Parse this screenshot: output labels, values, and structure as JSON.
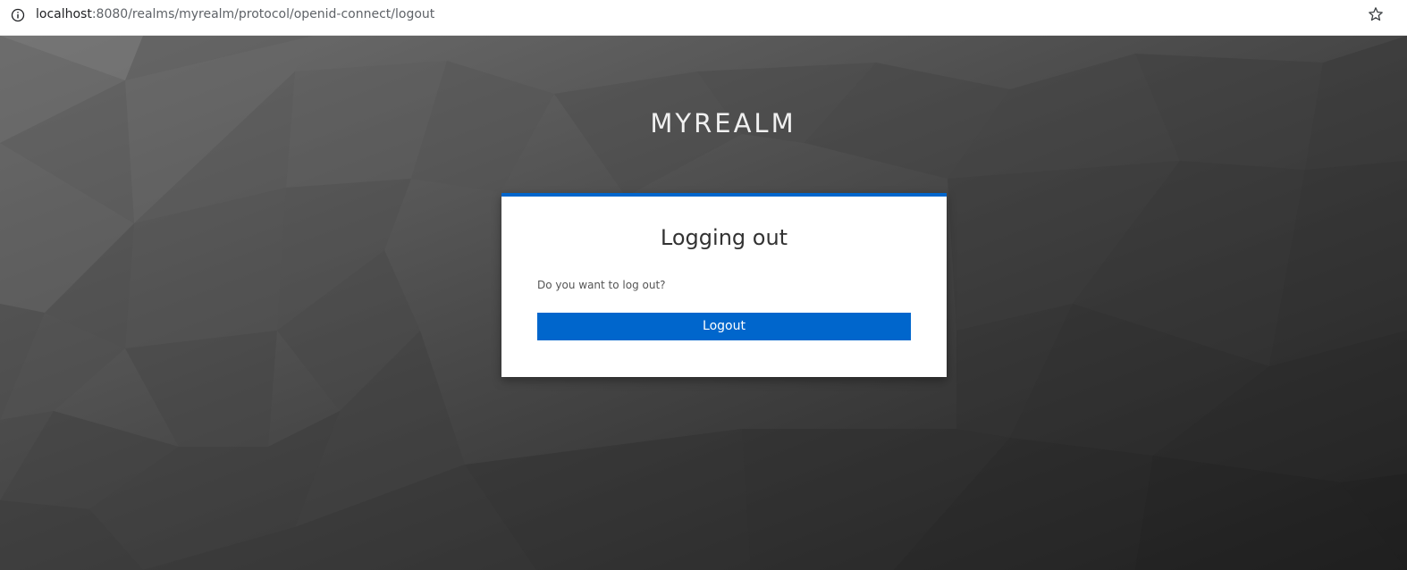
{
  "browser": {
    "url_host": "localhost",
    "url_rest": ":8080/realms/myrealm/protocol/openid-connect/logout"
  },
  "realm": {
    "name": "MYREALM"
  },
  "card": {
    "title": "Logging out",
    "question": "Do you want to log out?",
    "logout_label": "Logout"
  },
  "colors": {
    "accent": "#0066cc",
    "background_dark": "#1e1e1e",
    "background_light": "#6e6e6e"
  },
  "icons": {
    "address_bar_left": "info-icon",
    "address_bar_right": "star-icon"
  }
}
